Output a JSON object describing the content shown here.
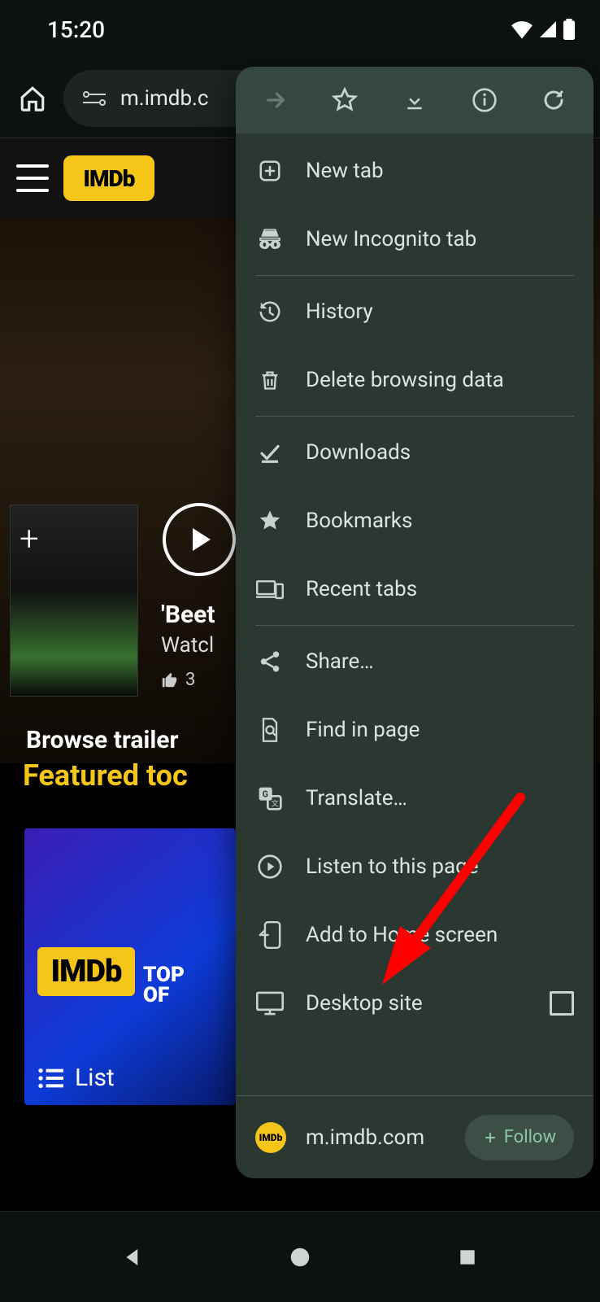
{
  "status": {
    "time": "15:20"
  },
  "browser": {
    "url_display": "m.imdb.c"
  },
  "page": {
    "logo_text": "IMDb",
    "hero": {
      "title_prefix": "'Beet",
      "subtitle_prefix": "Watcl",
      "likes_prefix": "3"
    },
    "section_label_truncated": "Browse trailer",
    "featured_heading_truncated": "Featured toc",
    "card": {
      "logo": "IMDb",
      "top_line": "TOP",
      "of_line": "OF",
      "list_label": "List"
    }
  },
  "menu_top": {
    "forward_disabled": true
  },
  "menu": {
    "new_tab": "New tab",
    "incognito": "New Incognito tab",
    "history": "History",
    "delete_data": "Delete browsing data",
    "downloads": "Downloads",
    "bookmarks": "Bookmarks",
    "recent_tabs": "Recent tabs",
    "share": "Share…",
    "find": "Find in page",
    "translate": "Translate…",
    "listen": "Listen to this page",
    "add_home": "Add to Home screen",
    "desktop": "Desktop site",
    "desktop_checked": false
  },
  "menu_footer": {
    "site": "m.imdb.com",
    "follow_label": "Follow"
  }
}
